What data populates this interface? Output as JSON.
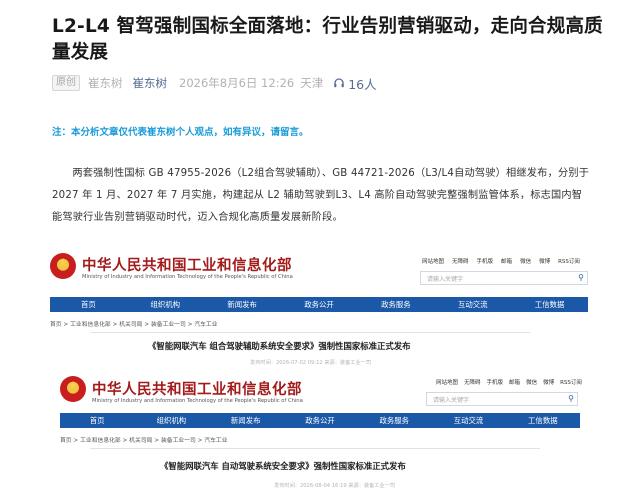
{
  "article": {
    "title": "L2-L4 智驾强制国标全面落地：行业告别营销驱动，走向合规高质量发展",
    "meta": {
      "badge": "原创",
      "author": "崔东树",
      "account": "崔东树",
      "date": "2026年8月6日 12:26",
      "location": "天津",
      "listen_count": "16人"
    },
    "note": "注：本分析文章仅代表崔东树个人观点，如有异议，请留言。",
    "paragraph": "两套强制性国标 GB 47955-2026（L2组合驾驶辅助）、GB 44721-2026（L3/L4自动驾驶）相继发布，分别于 2027 年 1 月、2027 年 7 月实施，构建起从 L2 辅助驾驶到L3、L4 高阶自动驾驶完整强制监管体系，标志国内智能驾驶行业告别营销驱动时代，迈入合规化高质量发展新阶段。"
  },
  "screenshot1": {
    "ministry_cn": "中华人民共和国工业和信息化部",
    "ministry_en": "Ministry of Industry and Information Technology of the People's Republic of China",
    "quick_links": [
      "网站地图",
      "无障碍",
      "手机版",
      "邮箱",
      "微信",
      "微博",
      "RSS订阅"
    ],
    "search_placeholder": "请输入关键字",
    "nav": [
      "首页",
      "组织机构",
      "新闻发布",
      "政务公开",
      "政务服务",
      "互动交流",
      "工信数据"
    ],
    "breadcrumb": "首页 > 工业和信息化部 > 机关司局 > 装备工业一司 > 汽车工业",
    "doc_title": "《智能网联汽车 组合驾驶辅助系统安全要求》强制性国家标准正式发布",
    "doc_meta": "发布时间：2026-07-02 09:12    来源：装备工业一司"
  },
  "screenshot2": {
    "ministry_cn": "中华人民共和国工业和信息化部",
    "ministry_en": "Ministry of Industry and Information Technology of the People's Republic of China",
    "quick_links": [
      "网站地图",
      "无障碍",
      "手机版",
      "邮箱",
      "微信",
      "微博",
      "RSS订阅"
    ],
    "search_placeholder": "请输入关键字",
    "nav": [
      "首页",
      "组织机构",
      "新闻发布",
      "政务公开",
      "政务服务",
      "互动交流",
      "工信数据"
    ],
    "breadcrumb": "首页 > 工业和信息化部 > 机关司局 > 装备工业一司 > 汽车工业",
    "doc_title": "《智能网联汽车 自动驾驶系统安全要求》强制性国家标准正式发布",
    "doc_meta": "发布时间：2026-08-04 16:19    来源：装备工业一司"
  },
  "colors": {
    "accent_link": "#576b95",
    "note": "#1a9bd7",
    "nav_bg": "#1b58a8",
    "ministry_red": "#a31b1b"
  },
  "icons": {
    "listen": "headphones-icon",
    "emblem": "national-emblem-icon",
    "search": "search-icon"
  }
}
